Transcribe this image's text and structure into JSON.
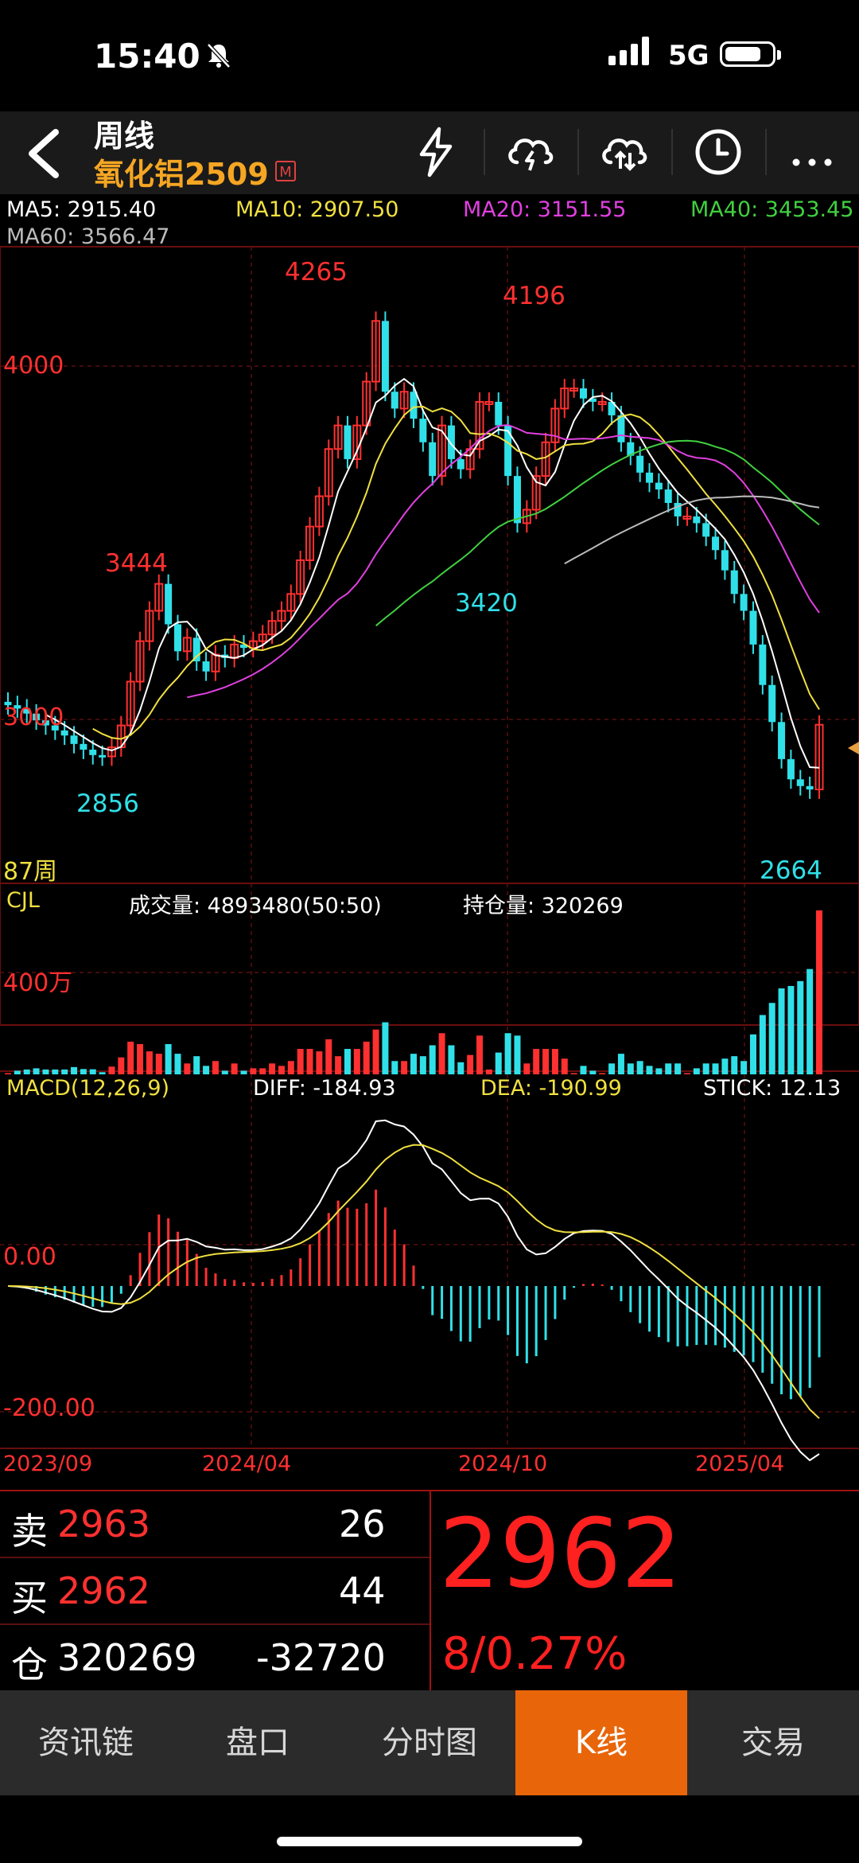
{
  "status": {
    "time": "15:40",
    "network": "5G"
  },
  "header": {
    "period": "周线",
    "symbol": "氧化铝2509",
    "market_badge": "M"
  },
  "ma": {
    "ma5": "MA5: 2915.40",
    "ma10": "MA10: 2907.50",
    "ma20": "MA20: 3151.55",
    "ma40": "MA40: 3453.45",
    "ma60": "MA60: 3566.47",
    "colors": {
      "ma5": "#ffffff",
      "ma10": "#f0e040",
      "ma20": "#e040e0",
      "ma40": "#40d040",
      "ma60": "#bbbbbb"
    }
  },
  "price_panel": {
    "axis_labels": [
      "4000",
      "3000"
    ],
    "annotations": {
      "high1": "4265",
      "high2": "4196",
      "high3": "3444",
      "low1": "2856",
      "low2": "3420",
      "low3": "2664"
    },
    "bar_count": "87周"
  },
  "volume_panel": {
    "name": "CJL",
    "volume": "成交量: 4893480(50:50)",
    "open_interest": "持仓量: 320269",
    "axis_label": "400万"
  },
  "macd_panel": {
    "name": "MACD(12,26,9)",
    "diff": "DIFF: -184.93",
    "dea": "DEA: -190.99",
    "stick": "STICK: 12.13",
    "axis_labels": [
      "0.00",
      "-200.00"
    ]
  },
  "x_axis": [
    "2023/09",
    "2024/04",
    "2024/10",
    "2025/04"
  ],
  "quote": {
    "sell_label": "卖",
    "sell_price": "2963",
    "sell_qty": "26",
    "buy_label": "买",
    "buy_price": "2962",
    "buy_qty": "44",
    "oi_label": "仓",
    "oi_value": "320269",
    "oi_change": "-32720",
    "last_price": "2962",
    "change": "8/0.27%"
  },
  "tabs": [
    {
      "label": "资讯链"
    },
    {
      "label": "盘口"
    },
    {
      "label": "分时图"
    },
    {
      "label": "K线",
      "active": true
    },
    {
      "label": "交易"
    }
  ],
  "colors": {
    "up": "#ff3030",
    "down": "#30e0e8",
    "accent": "#e8650a"
  },
  "chart_data": {
    "type": "candlestick",
    "period": "weekly",
    "x": [
      "2023/09",
      "2024/04",
      "2024/10",
      "2025/04"
    ],
    "close": [
      3020,
      3010,
      2995,
      2975,
      2960,
      2945,
      2930,
      2905,
      2888,
      2872,
      2868,
      2895,
      2960,
      3090,
      3210,
      3300,
      3380,
      3260,
      3180,
      3220,
      3150,
      3120,
      3170,
      3160,
      3200,
      3190,
      3210,
      3230,
      3270,
      3300,
      3350,
      3450,
      3550,
      3640,
      3780,
      3850,
      3750,
      3850,
      3980,
      4160,
      3950,
      3900,
      3950,
      3870,
      3800,
      3700,
      3850,
      3750,
      3720,
      3780,
      3920,
      3920,
      3850,
      3700,
      3560,
      3600,
      3700,
      3800,
      3900,
      3960,
      3960,
      3930,
      3920,
      3920,
      3880,
      3800,
      3760,
      3710,
      3680,
      3660,
      3620,
      3580,
      3580,
      3560,
      3520,
      3480,
      3420,
      3350,
      3300,
      3200,
      3080,
      2970,
      2860,
      2800,
      2780,
      2770,
      2962
    ],
    "highs_labeled": [
      4265,
      4196,
      3444
    ],
    "lows_labeled": [
      2856,
      3420,
      2664
    ],
    "ylim": [
      2600,
      4300
    ]
  }
}
